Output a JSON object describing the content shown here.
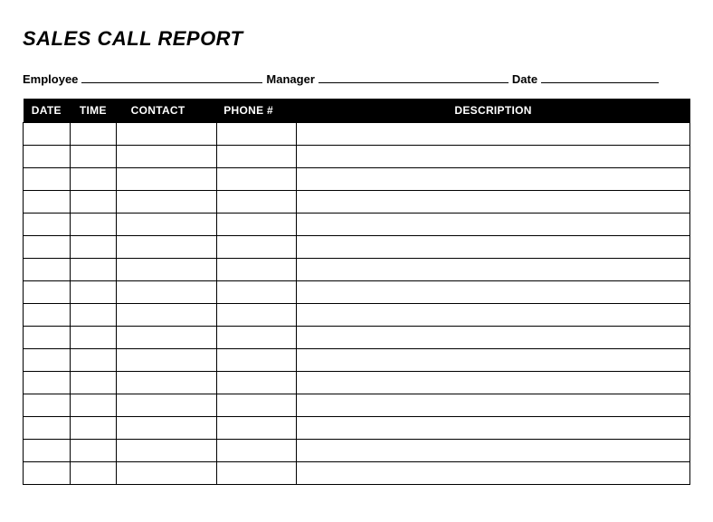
{
  "title": "SALES CALL REPORT",
  "form": {
    "employee_label": "Employee",
    "manager_label": "Manager",
    "date_label": "Date"
  },
  "columns": {
    "date": "DATE",
    "time": "TIME",
    "contact": "CONTACT",
    "phone": "PHONE #",
    "description": "DESCRIPTION"
  },
  "rows": [
    {
      "date": "",
      "time": "",
      "contact": "",
      "phone": "",
      "description": ""
    },
    {
      "date": "",
      "time": "",
      "contact": "",
      "phone": "",
      "description": ""
    },
    {
      "date": "",
      "time": "",
      "contact": "",
      "phone": "",
      "description": ""
    },
    {
      "date": "",
      "time": "",
      "contact": "",
      "phone": "",
      "description": ""
    },
    {
      "date": "",
      "time": "",
      "contact": "",
      "phone": "",
      "description": ""
    },
    {
      "date": "",
      "time": "",
      "contact": "",
      "phone": "",
      "description": ""
    },
    {
      "date": "",
      "time": "",
      "contact": "",
      "phone": "",
      "description": ""
    },
    {
      "date": "",
      "time": "",
      "contact": "",
      "phone": "",
      "description": ""
    },
    {
      "date": "",
      "time": "",
      "contact": "",
      "phone": "",
      "description": ""
    },
    {
      "date": "",
      "time": "",
      "contact": "",
      "phone": "",
      "description": ""
    },
    {
      "date": "",
      "time": "",
      "contact": "",
      "phone": "",
      "description": ""
    },
    {
      "date": "",
      "time": "",
      "contact": "",
      "phone": "",
      "description": ""
    },
    {
      "date": "",
      "time": "",
      "contact": "",
      "phone": "",
      "description": ""
    },
    {
      "date": "",
      "time": "",
      "contact": "",
      "phone": "",
      "description": ""
    },
    {
      "date": "",
      "time": "",
      "contact": "",
      "phone": "",
      "description": ""
    },
    {
      "date": "",
      "time": "",
      "contact": "",
      "phone": "",
      "description": ""
    }
  ]
}
